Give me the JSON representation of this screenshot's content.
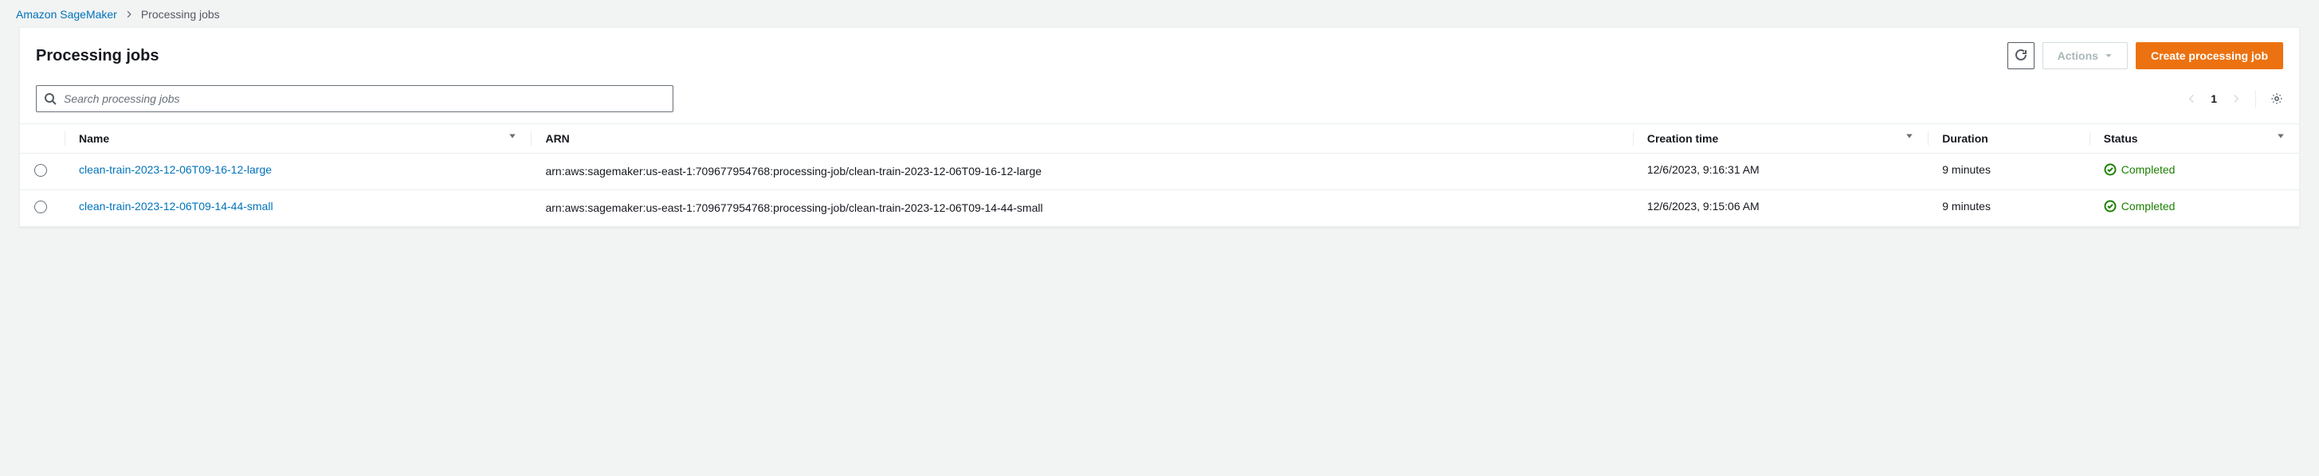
{
  "breadcrumb": {
    "parent": "Amazon SageMaker",
    "current": "Processing jobs"
  },
  "header": {
    "title": "Processing jobs",
    "actions_label": "Actions",
    "create_label": "Create processing job"
  },
  "search": {
    "placeholder": "Search processing jobs"
  },
  "pager": {
    "page": "1"
  },
  "columns": {
    "name": "Name",
    "arn": "ARN",
    "creation_time": "Creation time",
    "duration": "Duration",
    "status": "Status"
  },
  "rows": [
    {
      "name": "clean-train-2023-12-06T09-16-12-large",
      "arn": "arn:aws:sagemaker:us-east-1:709677954768:processing-job/clean-train-2023-12-06T09-16-12-large",
      "creation_time": "12/6/2023, 9:16:31 AM",
      "duration": "9 minutes",
      "status": "Completed"
    },
    {
      "name": "clean-train-2023-12-06T09-14-44-small",
      "arn": "arn:aws:sagemaker:us-east-1:709677954768:processing-job/clean-train-2023-12-06T09-14-44-small",
      "creation_time": "12/6/2023, 9:15:06 AM",
      "duration": "9 minutes",
      "status": "Completed"
    }
  ]
}
